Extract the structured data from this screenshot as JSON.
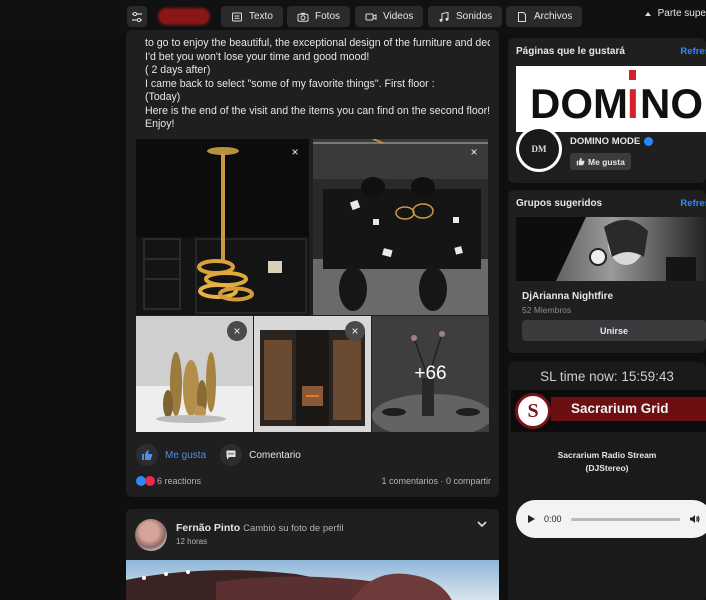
{
  "toolbar": {
    "tabs": [
      {
        "label": "Texto",
        "icon": "text-icon"
      },
      {
        "label": "Fotos",
        "icon": "camera-icon"
      },
      {
        "label": "Videos",
        "icon": "video-icon"
      },
      {
        "label": "Sonidos",
        "icon": "music-icon"
      },
      {
        "label": "Archivos",
        "icon": "file-icon"
      }
    ],
    "right_label": "Parte supe"
  },
  "post": {
    "text_lines": [
      "to go to enjoy the beautiful, the exceptional design of the furniture and decor!",
      "I'd bet you won't lose your time and good mood!",
      "( 2 days after)",
      "I came back to select \"some of my favorite things\". First floor :",
      "(Today)",
      "Here is the end of the visit and the items you can find on the second floor!",
      "Enjoy!"
    ],
    "close_glyph": "×",
    "more_photos": "+66",
    "like_label": "Me gusta",
    "comment_label": "Comentario",
    "reactions": "6 reactions",
    "comments_shares": "1 comentarios · 0 compartir"
  },
  "post2": {
    "author": "Fernão Pinto",
    "action": "Cambió su foto de perfil",
    "time": "12 horas"
  },
  "sidebar": {
    "pages": {
      "title": "Páginas que le gustará",
      "link": "Refres",
      "banner_text_left": "DOM",
      "banner_text_i": "I",
      "banner_text_right": "NO",
      "avatar_text": "DM",
      "name": "DOMINO MODE",
      "like_label": "Me gusta"
    },
    "groups": {
      "title": "Grupos sugeridos",
      "link": "Refres",
      "name": "DjArianna Nightfire",
      "members": "52 Miembros",
      "join_label": "Unirse"
    },
    "radio": {
      "sl_time": "SL time now: 15:59:43",
      "banner_logo": "S",
      "banner_text": "Sacrarium Grid",
      "stream_title": "Sacrarium Radio Stream",
      "stream_sub": "(DJStereo)",
      "player_time": "0:00"
    }
  },
  "colors": {
    "accent_blue": "#2d88ff",
    "brand_red": "#d8202a",
    "sacrarium_red": "#6b0f12"
  }
}
